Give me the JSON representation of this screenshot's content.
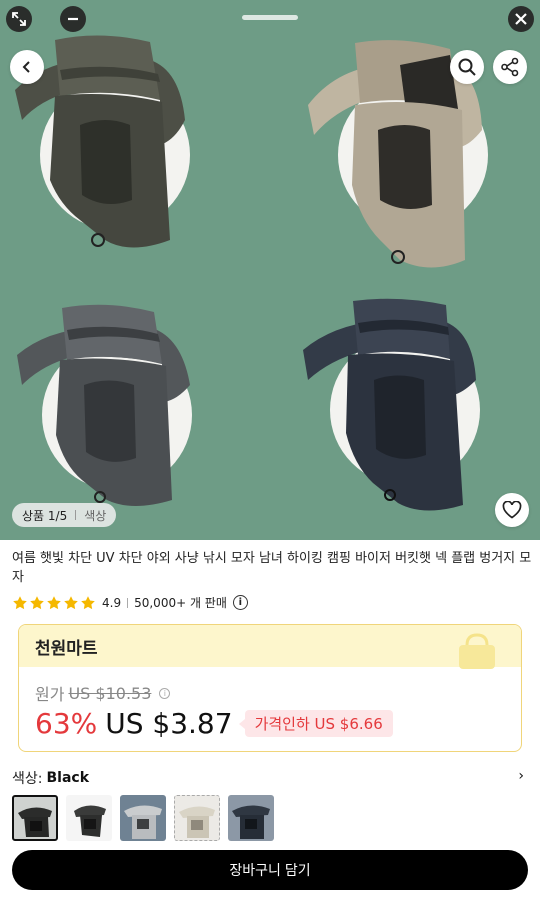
{
  "gallery": {
    "counter_label": "상품 1/5",
    "color_label": "색상"
  },
  "product": {
    "title": "여름 햇빛 차단 UV 차단 야외 사냥 낚시 모자 남녀 하이킹 캠핑 바이저 버킷햇 넥 플랩 벙거지 모자",
    "rating_value": "4.9",
    "rating_fraction": 0.98,
    "sold_text": "50,000+ 개 판매"
  },
  "deal": {
    "brand": "천원마트",
    "original_label": "원가",
    "original_price": "US $10.53",
    "discount": "63%",
    "price": "US $3.87",
    "price_drop": "가격인하 US $6.66",
    "colors": {
      "border": "#f0d57a",
      "header_bg": "#fdf6cc",
      "discount": "#e4393c",
      "drop_bg": "#fde6e8"
    }
  },
  "variant": {
    "label": "색상:",
    "selected": "Black",
    "swatches": [
      "black",
      "black-mesh",
      "grey",
      "khaki",
      "navy"
    ]
  },
  "cart": {
    "label": "장바구니 담기"
  },
  "icons": [
    "expand-icon",
    "minimize-icon",
    "close-icon",
    "back-icon",
    "search-icon",
    "share-icon",
    "heart-icon",
    "star-icon",
    "info-icon",
    "chevron-right-icon"
  ]
}
